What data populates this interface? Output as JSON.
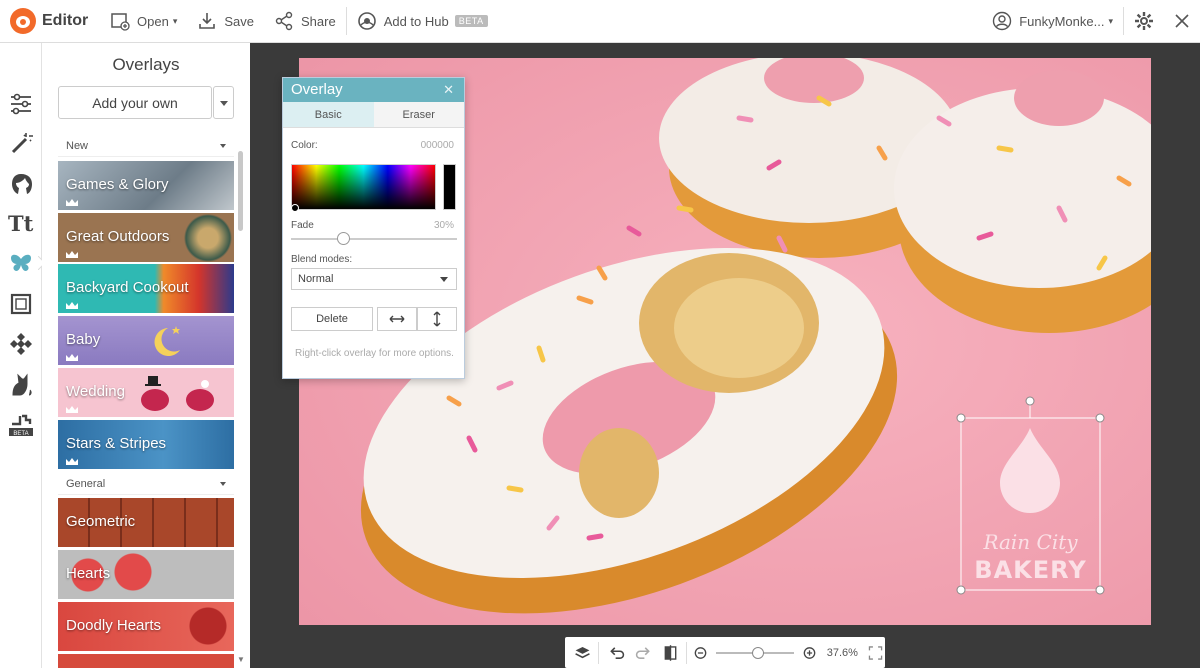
{
  "topbar": {
    "app_name": "Editor",
    "open_label": "Open",
    "save_label": "Save",
    "share_label": "Share",
    "add_to_hub_label": "Add to Hub",
    "beta_label": "BETA",
    "user_name": "FunkyMonke..."
  },
  "panel": {
    "title": "Overlays",
    "add_button_label": "Add your own",
    "sections": [
      {
        "label": "New"
      },
      {
        "label": "General"
      }
    ],
    "tiles": [
      {
        "label": "Games & Glory",
        "color": "#7a8a98"
      },
      {
        "label": "Great Outdoors",
        "color": "#8d6a4a"
      },
      {
        "label": "Backyard Cookout",
        "color": "#c23a2f"
      },
      {
        "label": "Baby",
        "color": "#9a86c8"
      },
      {
        "label": "Wedding",
        "color": "#f2b8c6"
      },
      {
        "label": "Stars & Stripes",
        "color": "#3a79a8"
      },
      {
        "label": "Geometric",
        "color": "#b6532d"
      },
      {
        "label": "Hearts",
        "color": "#c8c8c8"
      },
      {
        "label": "Doodly Hearts",
        "color": "#d8463c"
      }
    ]
  },
  "dialog": {
    "title": "Overlay",
    "tab_basic": "Basic",
    "tab_eraser": "Eraser",
    "color_label": "Color:",
    "color_value": "000000",
    "fade_label": "Fade",
    "fade_value": "30%",
    "blend_label": "Blend modes:",
    "blend_value": "Normal",
    "delete_label": "Delete",
    "hint": "Right-click overlay for more options."
  },
  "canvas": {
    "logo_line1": "Rain City",
    "logo_line2": "BAKERY"
  },
  "zoom": {
    "value": "37.6%"
  },
  "colors": {
    "accent": "#6ab3c0",
    "brand": "#f26a2a",
    "canvas_bg": "#f3a3b2"
  }
}
